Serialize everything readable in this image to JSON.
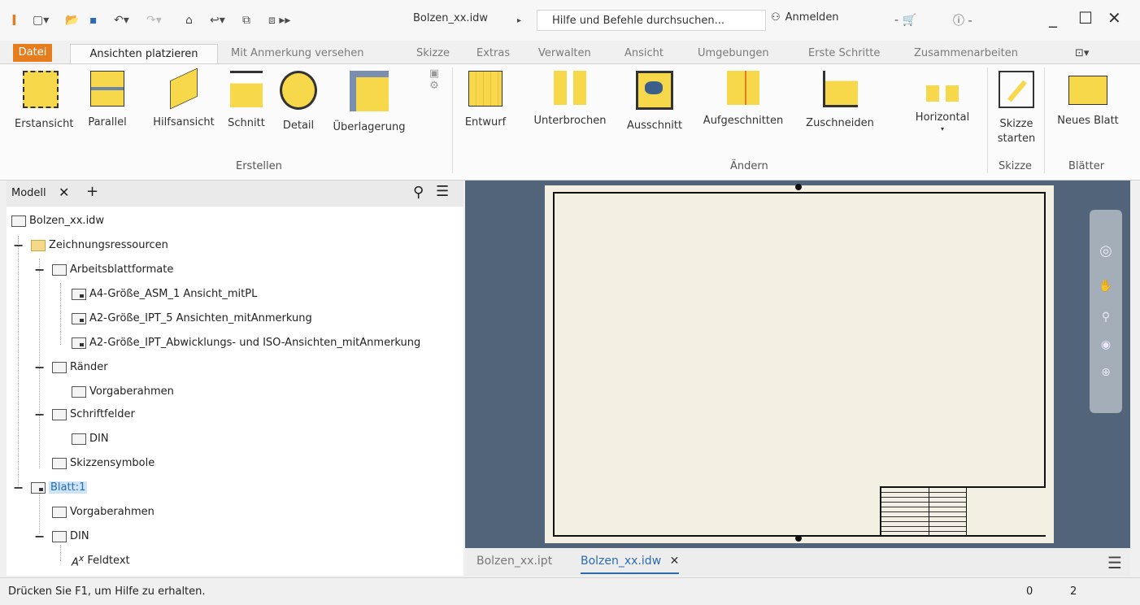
{
  "titlebar": {
    "document": "Bolzen_xx.idw",
    "search_placeholder": "Hilfe und Befehle durchsuchen...",
    "login": "Anmelden"
  },
  "tabs": [
    "Datei",
    "Ansichten platzieren",
    "Mit Anmerkung versehen",
    "Skizze",
    "Extras",
    "Verwalten",
    "Ansicht",
    "Umgebungen",
    "Erste Schritte",
    "Zusammenarbeiten"
  ],
  "ribbon": {
    "erstellen": {
      "title": "Erstellen",
      "buttons": [
        "Erstansicht",
        "Parallel",
        "Hilfsansicht",
        "Schnitt",
        "Detail",
        "Überlagerung"
      ]
    },
    "aendern": {
      "title": "Ändern",
      "buttons": [
        "Entwurf",
        "Unterbrochen",
        "Ausschnitt",
        "Aufgeschnitten",
        "Zuschneiden",
        "Horizontal"
      ]
    },
    "skizze": {
      "title": "Skizze",
      "button_line1": "Skizze",
      "button_line2": "starten"
    },
    "blaetter": {
      "title": "Blätter",
      "button": "Neues Blatt"
    }
  },
  "browser": {
    "tab": "Modell",
    "items": [
      "Bolzen_xx.idw",
      "Zeichnungsressourcen",
      "Arbeitsblattformate",
      "A4-Größe_ASM_1 Ansicht_mitPL",
      "A2-Größe_IPT_5 Ansichten_mitAnmerkung",
      "A2-Größe_IPT_Abwicklungs- und ISO-Ansichten_mitAnmerkung",
      "Ränder",
      "Vorgaberahmen",
      "Schriftfelder",
      "DIN",
      "Skizzensymbole",
      "Blatt:1",
      "Vorgaberahmen",
      "DIN",
      "Feldtext"
    ]
  },
  "doctabs": [
    "Bolzen_xx.ipt",
    "Bolzen_xx.idw"
  ],
  "status": {
    "text": "Drücken Sie F1, um Hilfe zu erhalten.",
    "count1": "0",
    "count2": "2"
  },
  "colors": {
    "file_tab": "#e57c1e",
    "canvas_bg": "#52647a",
    "sheet": "#f3efe2",
    "accent": "#2c6bb0"
  }
}
